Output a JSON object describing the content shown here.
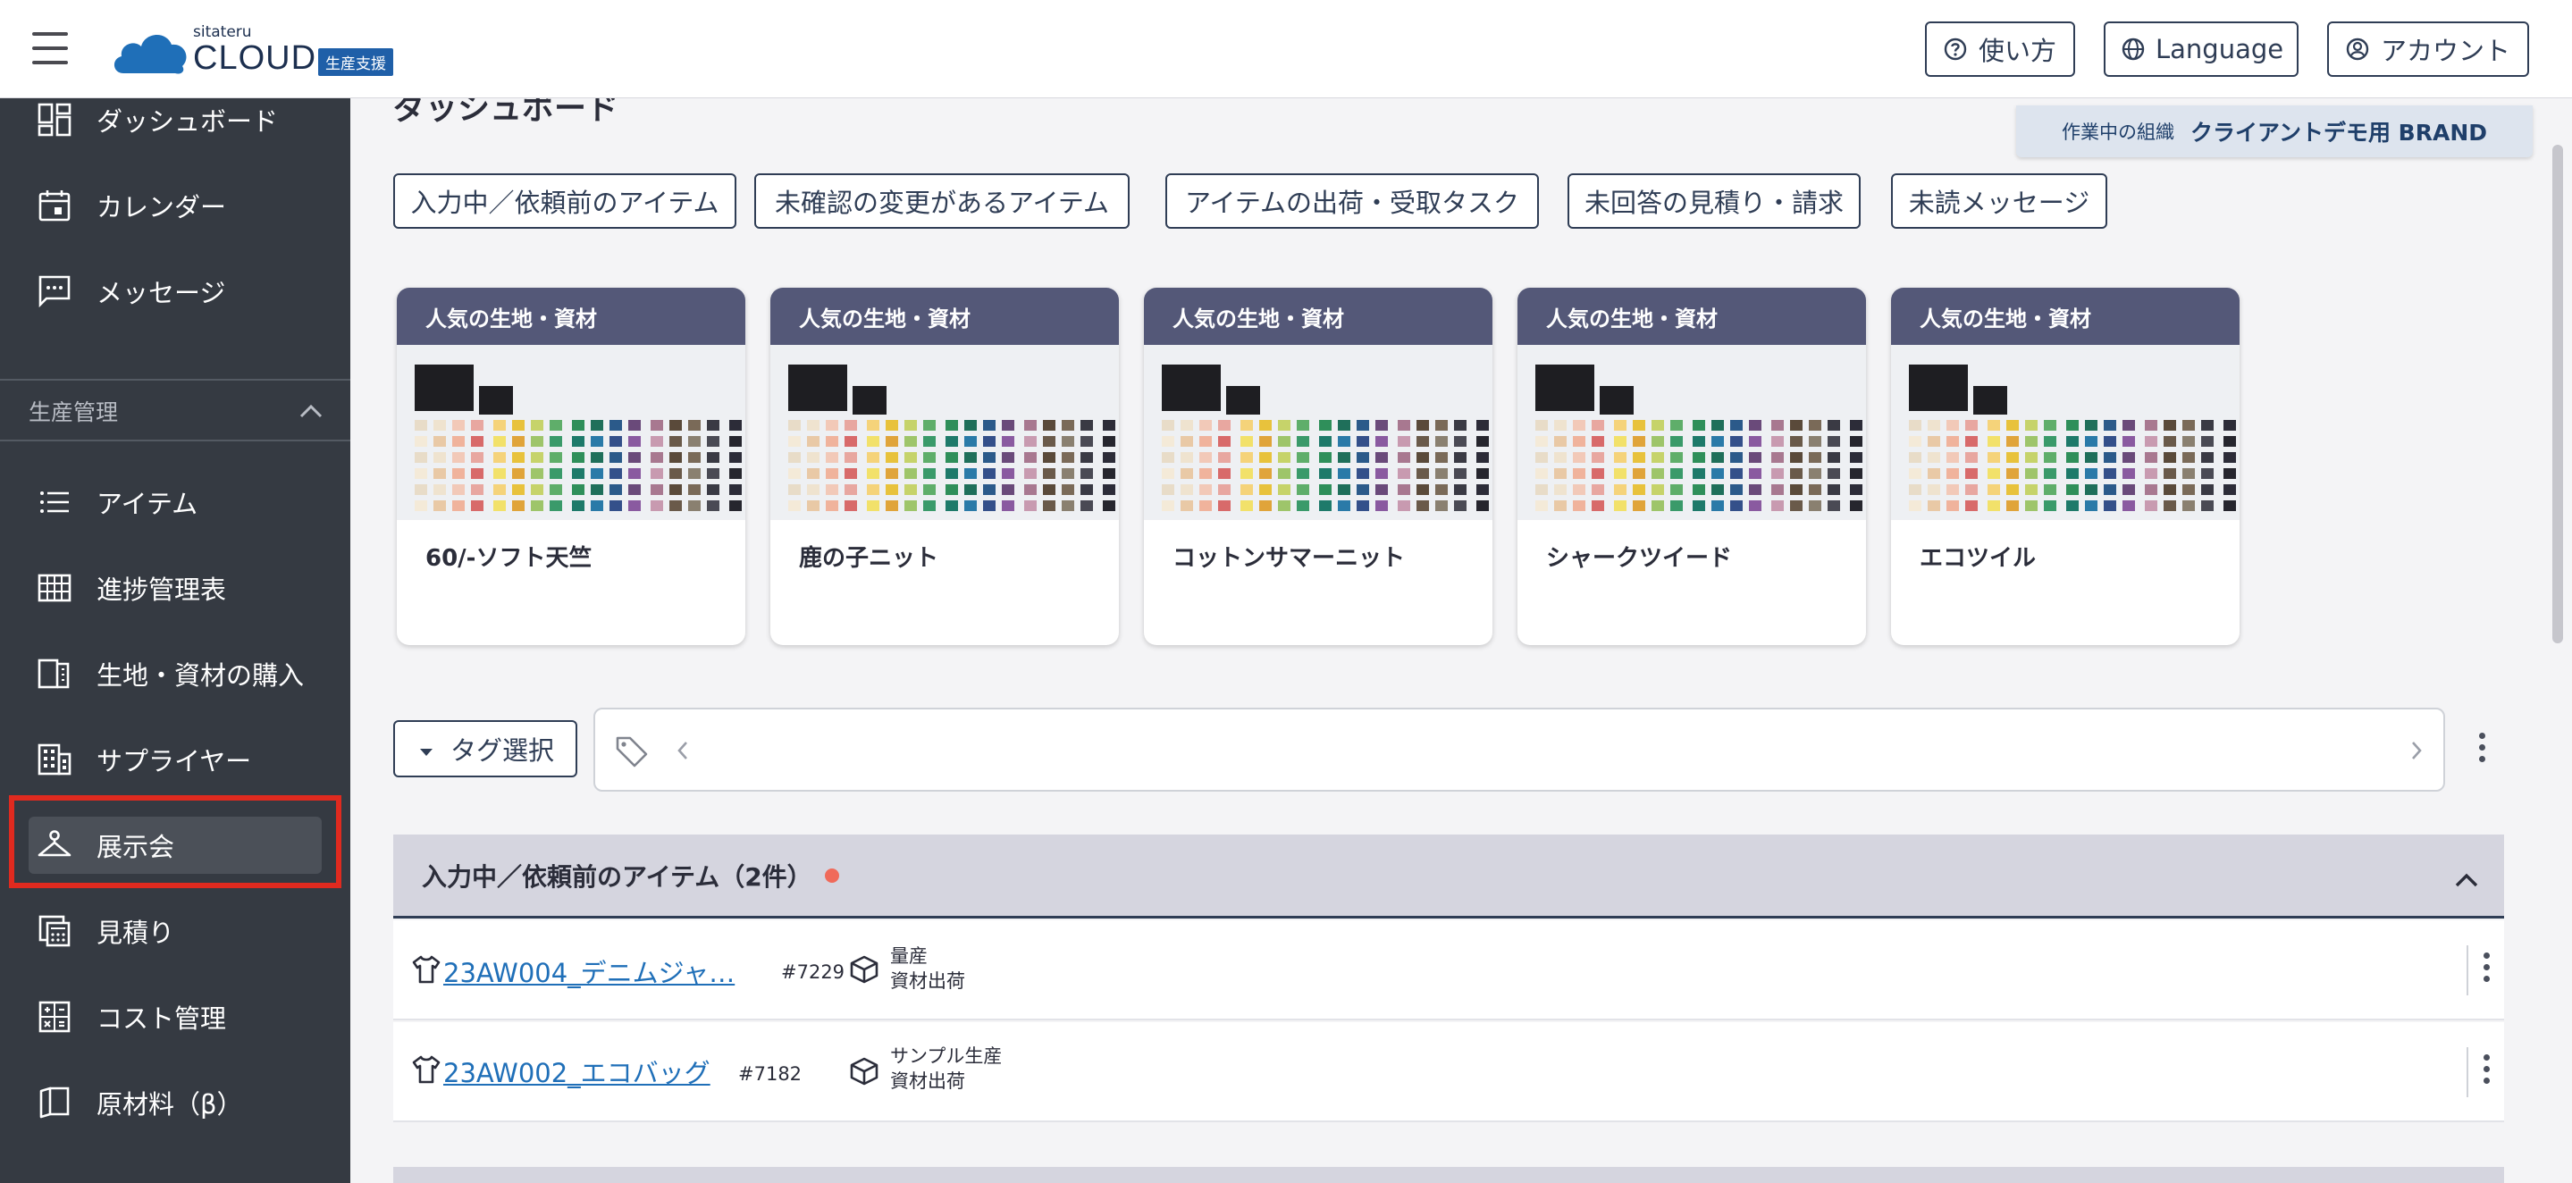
{
  "header": {
    "logo_small": "sitateru",
    "logo_main": "CLOUD",
    "logo_badge": "生産支援",
    "help_label": "使い方",
    "language_label": "Language",
    "account_label": "アカウント"
  },
  "sidebar": {
    "top_items": [
      {
        "label": "ダッシュボード",
        "icon": "dashboard-icon"
      },
      {
        "label": "カレンダー",
        "icon": "calendar-icon"
      },
      {
        "label": "メッセージ",
        "icon": "message-icon"
      }
    ],
    "section_label": "生産管理",
    "section_items": [
      {
        "label": "アイテム",
        "icon": "list-icon"
      },
      {
        "label": "進捗管理表",
        "icon": "grid-table-icon"
      },
      {
        "label": "生地・資材の購入",
        "icon": "fabric-icon"
      },
      {
        "label": "サプライヤー",
        "icon": "building-icon"
      },
      {
        "label": "展示会",
        "icon": "hanger-icon",
        "active": true
      },
      {
        "label": "見積り",
        "icon": "calculator-icon"
      },
      {
        "label": "コスト管理",
        "icon": "cost-calculator-icon"
      },
      {
        "label": "原材料（β）",
        "icon": "material-book-icon"
      }
    ]
  },
  "main": {
    "page_title": "ダッシュボード",
    "org_label": "作業中の組織",
    "org_name": "クライアントデモ用 BRAND",
    "filters": [
      "入力中／依頼前のアイテム",
      "未確認の変更があるアイテム",
      "アイテムの出荷・受取タスク",
      "未回答の見積り・請求",
      "未読メッセージ"
    ],
    "cards": [
      {
        "header": "人気の生地・資材",
        "name": "60/-ソフト天竺"
      },
      {
        "header": "人気の生地・資材",
        "name": "鹿の子ニット"
      },
      {
        "header": "人気の生地・資材",
        "name": "コットンサマーニット"
      },
      {
        "header": "人気の生地・資材",
        "name": "シャークツイード"
      },
      {
        "header": "人気の生地・資材",
        "name": "エコツイル"
      }
    ],
    "tag_select_label": "タグ選択",
    "section_title": "入力中／依頼前のアイテム（2件）",
    "rows": [
      {
        "link": "23AW004_デニムジャ…",
        "id": "#7229",
        "tag1": "量産",
        "tag2": "資材出荷"
      },
      {
        "link": "23AW002_エコバッグ",
        "id": "#7182",
        "tag1": "サンプル生産",
        "tag2": "資材出荷"
      }
    ]
  },
  "colors": {
    "sidebar_bg": "#353a42",
    "card_header": "#545878",
    "link": "#1f6fb8",
    "highlight": "#e02a1f",
    "status_dot": "#f06a5a"
  }
}
